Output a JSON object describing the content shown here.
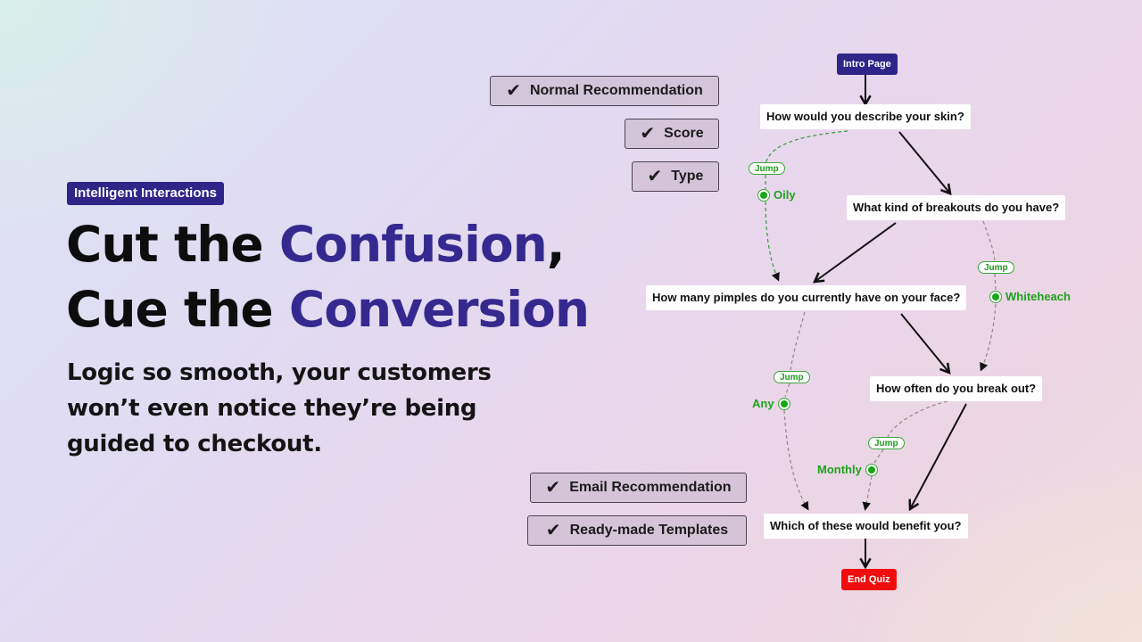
{
  "hero": {
    "badge": "Intelligent Interactions",
    "headline": {
      "line1_plain": "Cut the ",
      "line1_accent": "Confusion",
      "line1_tail": ",",
      "line2_plain": "Cue the ",
      "line2_accent": "Conversion"
    },
    "subhead": "Logic so smooth, your customers won’t even notice they’re being guided to checkout."
  },
  "features": [
    {
      "label": "Normal Recommendation",
      "icon": "check-icon"
    },
    {
      "label": "Score",
      "icon": "check-icon"
    },
    {
      "label": "Type",
      "icon": "check-icon"
    },
    {
      "label": "Email Recommendation",
      "icon": "check-icon"
    },
    {
      "label": "Ready-made Templates",
      "icon": "check-icon"
    }
  ],
  "check_glyph": "✔",
  "flow": {
    "start": "Intro Page",
    "questions": [
      "How would you describe your skin?",
      "What kind of breakouts do you have?",
      "How many pimples do you currently have on your face?",
      "How often do you break out?",
      "Which of these would benefit you?"
    ],
    "end": "End Quiz",
    "jump_label": "Jump",
    "conditions": [
      "Oily",
      "Whiteheach",
      "Any",
      "Monthly"
    ]
  },
  "colors": {
    "brand": "#2f2589",
    "accent_text": "#35298f",
    "end": "#f00d0d",
    "jump_green": "#1da11d"
  }
}
